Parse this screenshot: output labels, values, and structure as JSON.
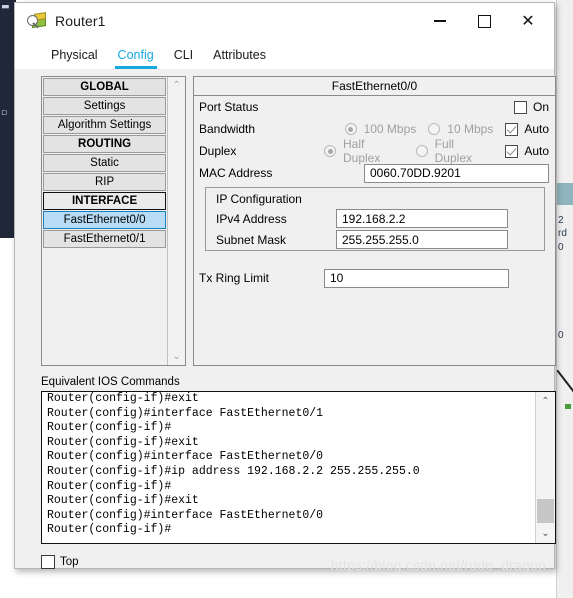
{
  "window": {
    "title": "Router1",
    "icon": "router-magnifier-icon",
    "controls": {
      "minimize": "—",
      "maximize": "□",
      "close": "✕"
    }
  },
  "tabs": [
    {
      "label": "Physical",
      "active": false
    },
    {
      "label": "Config",
      "active": true
    },
    {
      "label": "CLI",
      "active": false
    },
    {
      "label": "Attributes",
      "active": false
    }
  ],
  "sidebar": {
    "items": [
      {
        "label": "GLOBAL",
        "type": "header",
        "selected": false
      },
      {
        "label": "Settings",
        "type": "item",
        "selected": false
      },
      {
        "label": "Algorithm Settings",
        "type": "item",
        "selected": false
      },
      {
        "label": "ROUTING",
        "type": "header",
        "selected": false
      },
      {
        "label": "Static",
        "type": "item",
        "selected": false
      },
      {
        "label": "RIP",
        "type": "item",
        "selected": false
      },
      {
        "label": "INTERFACE",
        "type": "header-boxed",
        "selected": false
      },
      {
        "label": "FastEthernet0/0",
        "type": "item",
        "selected": true
      },
      {
        "label": "FastEthernet0/1",
        "type": "item",
        "selected": false
      }
    ],
    "scroll_up": "⌃",
    "scroll_down": "⌄"
  },
  "interface_panel": {
    "header": "FastEthernet0/0",
    "port_status": {
      "label": "Port Status",
      "on_label": "On",
      "on_checked": false
    },
    "bandwidth": {
      "label": "Bandwidth",
      "options": [
        {
          "label": "100 Mbps",
          "selected": true
        },
        {
          "label": "10 Mbps",
          "selected": false
        }
      ],
      "auto_label": "Auto",
      "auto_checked": true
    },
    "duplex": {
      "label": "Duplex",
      "options": [
        {
          "label": "Half Duplex",
          "selected": true
        },
        {
          "label": "Full Duplex",
          "selected": false
        }
      ],
      "auto_label": "Auto",
      "auto_checked": true
    },
    "mac_address": {
      "label": "MAC Address",
      "value": "0060.70DD.9201"
    },
    "ip_configuration": {
      "title": "IP Configuration",
      "ipv4": {
        "label": "IPv4 Address",
        "value": "192.168.2.2"
      },
      "subnet": {
        "label": "Subnet Mask",
        "value": "255.255.255.0"
      }
    },
    "tx_ring_limit": {
      "label": "Tx Ring Limit",
      "value": "10"
    }
  },
  "ios_commands": {
    "label": "Equivalent IOS Commands",
    "text": "Router(config-if)#exit\nRouter(config)#interface FastEthernet0/1\nRouter(config-if)#\nRouter(config-if)#exit\nRouter(config)#interface FastEthernet0/0\nRouter(config-if)#ip address 192.168.2.2 255.255.255.0\nRouter(config-if)#\nRouter(config-if)#exit\nRouter(config)#interface FastEthernet0/0\nRouter(config-if)#",
    "scroll_up": "⌃",
    "scroll_down": "⌄"
  },
  "footer": {
    "top_label": "Top",
    "top_checked": false
  },
  "watermark": "https://blog.csdn.net/rude_dragon",
  "colors": {
    "accent": "#17a8e0",
    "selection": "#b8dcf5",
    "selection_border": "#1a7fc1",
    "panel": "#f0f0f0",
    "field_bg": "#ffffff"
  },
  "background": {
    "left_panel_glyphs": [
      "■",
      "■"
    ],
    "right_fragments": [
      "2",
      "rd",
      "0",
      "0"
    ]
  }
}
